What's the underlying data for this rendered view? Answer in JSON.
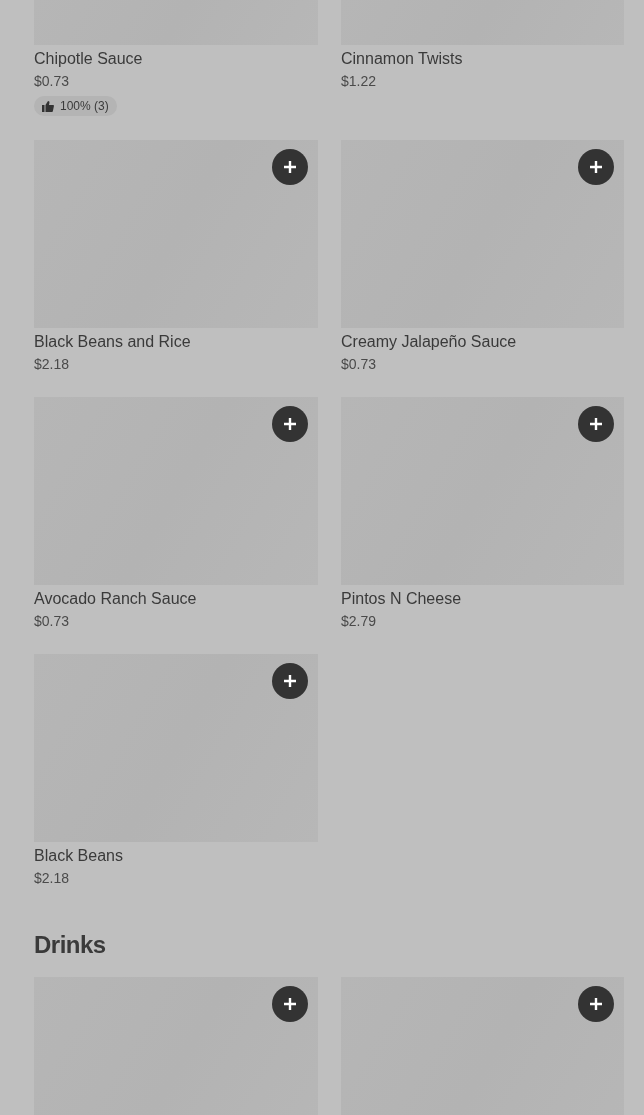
{
  "sections": [
    {
      "items": [
        {
          "name": "Chipotle Sauce",
          "price": "$0.73",
          "rating": "100% (3)",
          "add_button": false
        },
        {
          "name": "Cinnamon Twists",
          "price": "$1.22",
          "add_button": false
        },
        {
          "name": "Black Beans and Rice",
          "price": "$2.18",
          "add_button": true
        },
        {
          "name": "Creamy Jalapeño Sauce",
          "price": "$0.73",
          "add_button": true
        },
        {
          "name": "Avocado Ranch Sauce",
          "price": "$0.73",
          "add_button": true
        },
        {
          "name": "Pintos N Cheese",
          "price": "$2.79",
          "add_button": true
        },
        {
          "name": "Black Beans",
          "price": "$2.18",
          "add_button": true
        }
      ]
    },
    {
      "heading": "Drinks",
      "items": [
        {
          "add_button": true
        },
        {
          "add_button": true
        }
      ]
    }
  ]
}
